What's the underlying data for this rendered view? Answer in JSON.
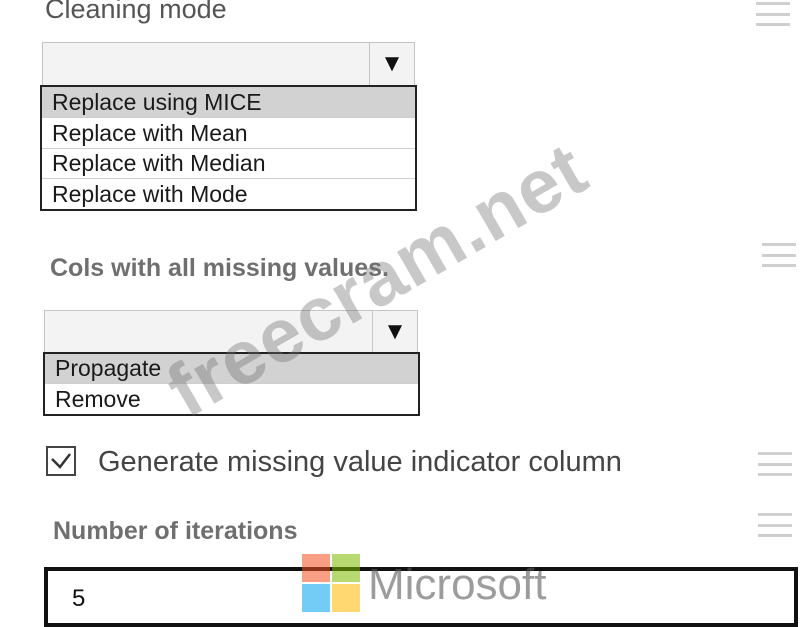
{
  "cleaning_mode": {
    "title": "Cleaning mode",
    "selected_value": "",
    "options": [
      "Replace using MICE",
      "Replace with Mean",
      "Replace with Median",
      "Replace with Mode"
    ],
    "highlighted_index": 0
  },
  "cols_missing": {
    "title": "Cols with all missing values.",
    "selected_value": "",
    "options": [
      "Propagate",
      "Remove"
    ],
    "highlighted_index": 0
  },
  "indicator": {
    "label": "Generate missing value indicator column",
    "checked": true
  },
  "iterations": {
    "title": "Number of iterations",
    "value": "5"
  },
  "icons": {
    "dropdown_arrow": "triangle-down-icon",
    "menu": "hamburger-menu-icon",
    "check": "checkmark-icon"
  },
  "watermark": {
    "text": "freecram.net",
    "brand": "Microsoft",
    "logo_colors": [
      "#f25022",
      "#7fba00",
      "#00a4ef",
      "#ffb900"
    ]
  }
}
